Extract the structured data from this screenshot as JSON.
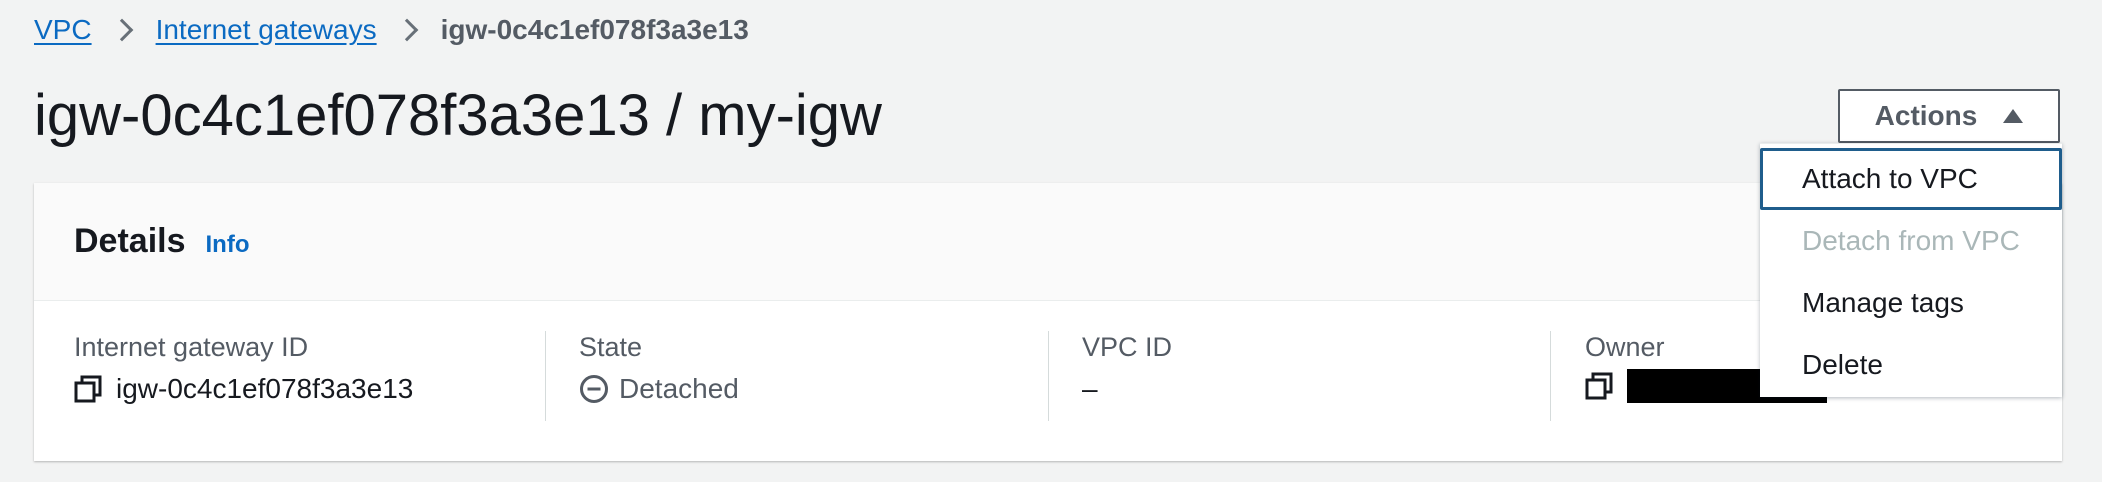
{
  "breadcrumb": {
    "items": [
      {
        "label": "VPC"
      },
      {
        "label": "Internet gateways"
      },
      {
        "label": "igw-0c4c1ef078f3a3e13"
      }
    ]
  },
  "page": {
    "title": "igw-0c4c1ef078f3a3e13 / my-igw"
  },
  "actions": {
    "label": "Actions",
    "expanded": true,
    "menu": [
      {
        "label": "Attach to VPC",
        "state": "focused"
      },
      {
        "label": "Detach from VPC",
        "state": "disabled"
      },
      {
        "label": "Manage tags",
        "state": "enabled"
      },
      {
        "label": "Delete",
        "state": "enabled"
      }
    ]
  },
  "details": {
    "title": "Details",
    "info_label": "Info",
    "fields": {
      "gateway_id": {
        "label": "Internet gateway ID",
        "value": "igw-0c4c1ef078f3a3e13",
        "icon": "copy-icon"
      },
      "state": {
        "label": "State",
        "value": "Detached",
        "icon": "minus-circle-icon"
      },
      "vpc_id": {
        "label": "VPC ID",
        "value": "–"
      },
      "owner": {
        "label": "Owner",
        "value_redacted": true,
        "icon": "copy-icon"
      }
    }
  },
  "colors": {
    "link": "#0b6ac2",
    "text_primary": "#16191f",
    "text_secondary": "#545b64",
    "disabled": "#aab7b8",
    "focus_border": "#1f5d8c",
    "page_background": "#f2f3f3"
  }
}
